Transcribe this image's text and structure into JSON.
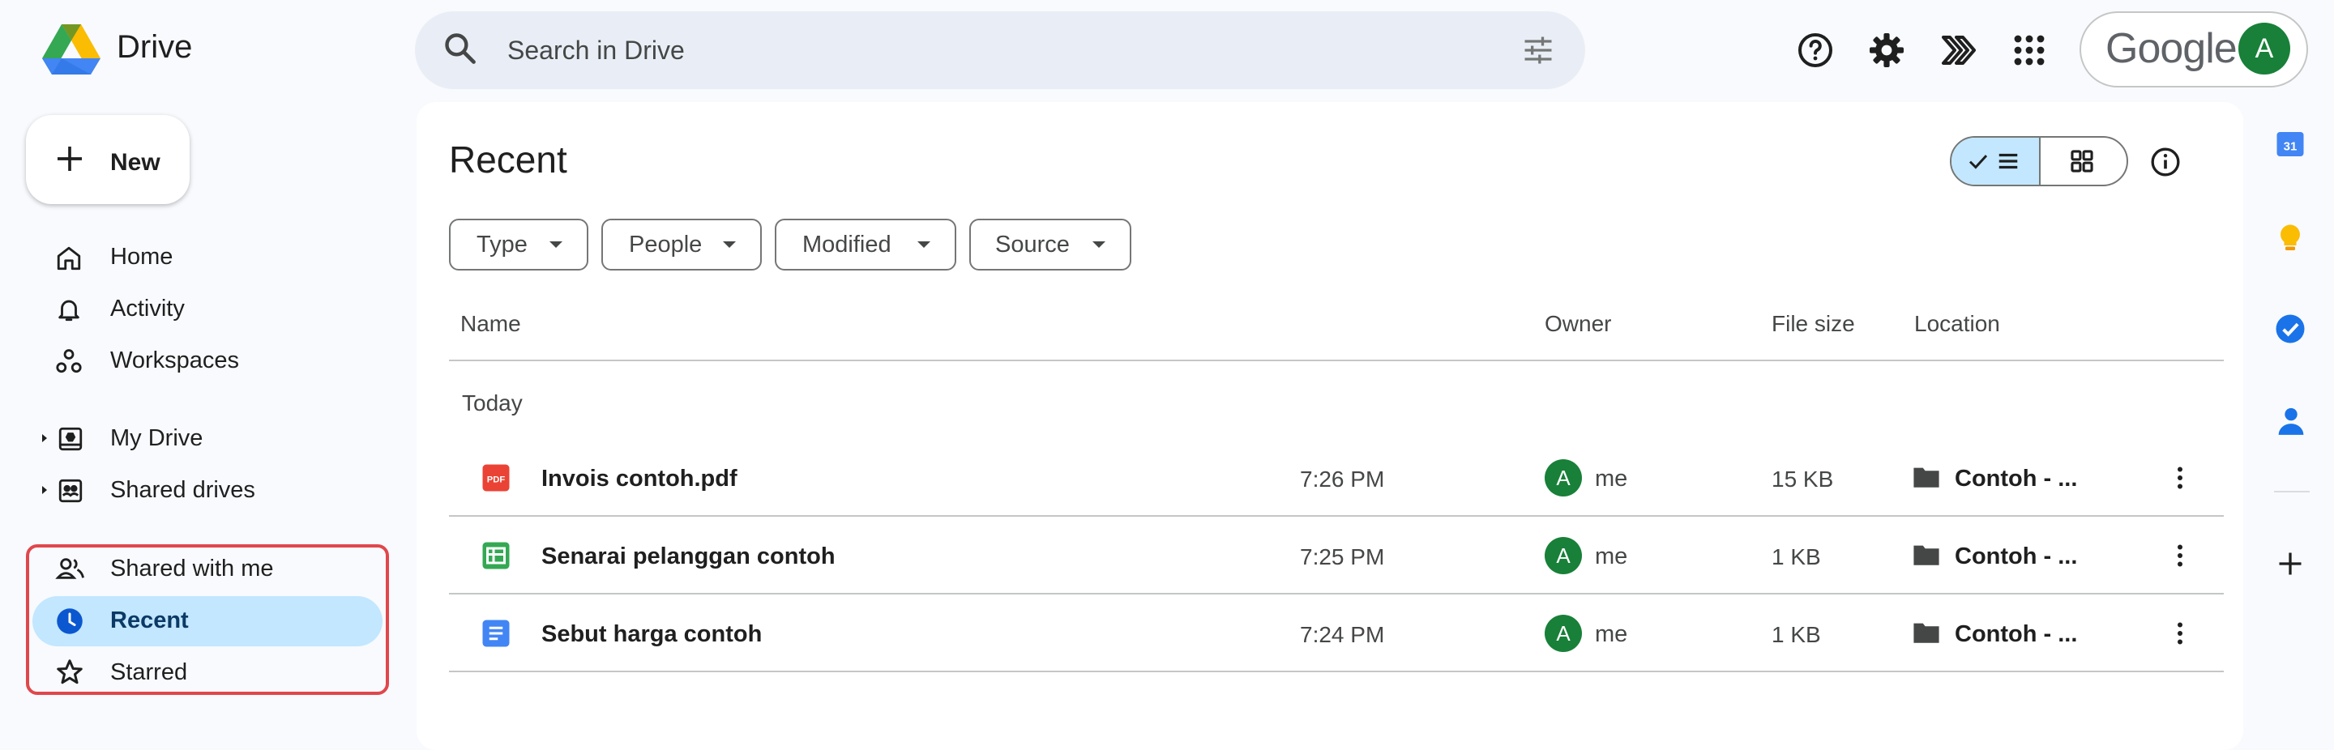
{
  "app": {
    "title": "Drive",
    "search_placeholder": "Search in Drive",
    "google_label": "Google",
    "account_initial": "A"
  },
  "sidebar": {
    "new_label": "New",
    "items": [
      {
        "label": "Home",
        "icon": "home-icon"
      },
      {
        "label": "Activity",
        "icon": "bell-icon"
      },
      {
        "label": "Workspaces",
        "icon": "workspaces-icon"
      },
      {
        "label": "My Drive",
        "icon": "my-drive-icon"
      },
      {
        "label": "Shared drives",
        "icon": "shared-drives-icon"
      },
      {
        "label": "Shared with me",
        "icon": "people-icon"
      },
      {
        "label": "Recent",
        "icon": "clock-icon",
        "selected": true
      },
      {
        "label": "Starred",
        "icon": "star-icon"
      }
    ]
  },
  "main": {
    "title": "Recent",
    "filters": [
      "Type",
      "People",
      "Modified",
      "Source"
    ],
    "columns": {
      "name": "Name",
      "owner": "Owner",
      "size": "File size",
      "location": "Location"
    },
    "group_label": "Today",
    "rows": [
      {
        "name": "Invois contoh.pdf",
        "type": "pdf",
        "time": "7:26 PM",
        "owner_initial": "A",
        "owner": "me",
        "size": "15 KB",
        "location": "Contoh - ..."
      },
      {
        "name": "Senarai pelanggan contoh",
        "type": "sheets",
        "time": "7:25 PM",
        "owner_initial": "A",
        "owner": "me",
        "size": "1 KB",
        "location": "Contoh - ..."
      },
      {
        "name": "Sebut harga contoh",
        "type": "docs",
        "time": "7:24 PM",
        "owner_initial": "A",
        "owner": "me",
        "size": "1 KB",
        "location": "Contoh - ..."
      }
    ]
  },
  "side_panel": {
    "calendar_date": "31",
    "icons": [
      "calendar-icon",
      "keep-icon",
      "tasks-icon",
      "contacts-icon",
      "add-icon"
    ]
  },
  "colors": {
    "accent": "#c2e7ff",
    "highlight": "#e0474c",
    "avatar": "#188038",
    "pdf": "#ea4335",
    "sheets": "#34a853",
    "docs": "#4285f4"
  }
}
